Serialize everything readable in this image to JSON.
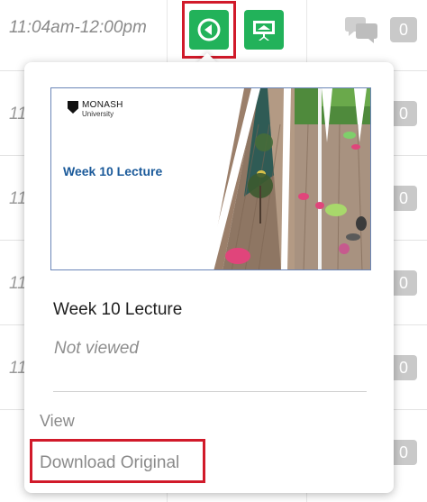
{
  "rows": {
    "time_range": "11:04am-12:00pm",
    "partial_time": "11:"
  },
  "badges": {
    "comment_count": "0"
  },
  "popover": {
    "thumbnail": {
      "university_name": "MONASH",
      "university_sub": "University",
      "slide_title": "Week 10 Lecture"
    },
    "recording_title": "Week 10 Lecture",
    "view_status": "Not viewed",
    "menu": {
      "view": "View",
      "download": "Download Original"
    }
  },
  "icons": {
    "play_button": "back-play-circle-icon",
    "presentation_button": "presentation-screen-icon",
    "comments": "comments-icon"
  },
  "colors": {
    "green_button": "#22b25a",
    "highlight": "#d11a2a",
    "badge": "#c9c9c9"
  }
}
